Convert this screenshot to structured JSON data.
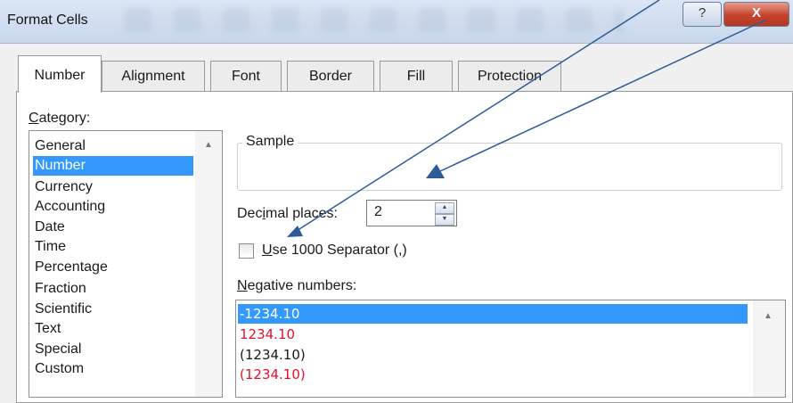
{
  "window": {
    "title": "Format Cells",
    "help_glyph": "?",
    "close_glyph": "X"
  },
  "tabs": [
    {
      "label": "Number",
      "active": true
    },
    {
      "label": "Alignment"
    },
    {
      "label": "Font"
    },
    {
      "label": "Border"
    },
    {
      "label": "Fill"
    },
    {
      "label": "Protection"
    }
  ],
  "category": {
    "label_underlined": "C",
    "label_rest": "ategory:",
    "items": [
      "General",
      "Number",
      "Currency",
      "Accounting",
      "Date",
      "Time",
      "Percentage",
      "Fraction",
      "Scientific",
      "Text",
      "Special",
      "Custom"
    ],
    "selected": "Number"
  },
  "sample": {
    "label": "Sample"
  },
  "decimal_places": {
    "label_pre": "Dec",
    "label_underlined": "i",
    "label_post": "mal places:",
    "value": "2"
  },
  "separator": {
    "label_underlined": "U",
    "label_rest": "se 1000 Separator (,)",
    "checked": false
  },
  "negative_numbers": {
    "label_underlined": "N",
    "label_rest": "egative numbers:",
    "items": [
      "-1234.10",
      "1234.10",
      "(1234.10)",
      "(1234.10)"
    ],
    "red_items": [
      false,
      true,
      false,
      true
    ],
    "selected_index": 0
  },
  "colors": {
    "selection": "#3399ff",
    "negative_red": "#e8102a",
    "annotation_arrow": "#2d5b98"
  },
  "annotations": {
    "arrow_count": 2,
    "color": "#2d5b98"
  }
}
